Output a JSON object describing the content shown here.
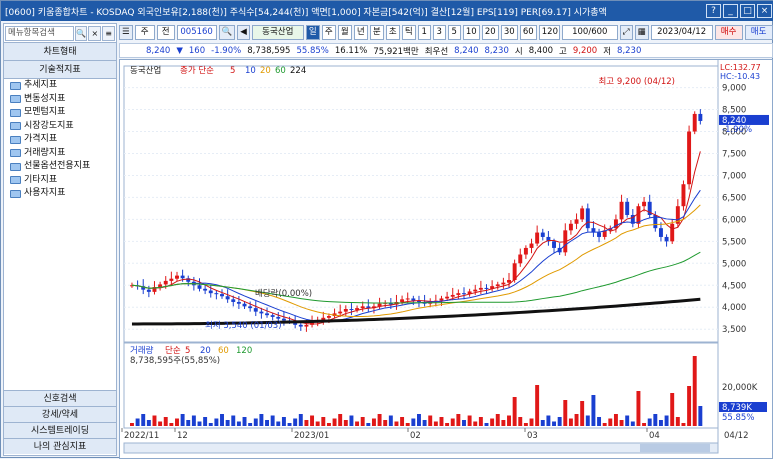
{
  "title": {
    "text": "[0600] 키움종합차트 - KOSDAQ 외국인보유[2,188(천)] 주식수[54,244(천)] 액면[1,000] 자본금[542(억)] 결산[12월] EPS[119] PER[69.17] 시가총액",
    "buttons": [
      "?",
      "_",
      "□",
      "×"
    ]
  },
  "sidebar": {
    "search_placeholder": "메뉴항목검색",
    "search_icon": "search-icon",
    "tab_chart_type": "차트형태",
    "tab_technical": "기술적지표",
    "items": [
      "추세지표",
      "변동성지표",
      "모멘텀지표",
      "시장강도지표",
      "가격지표",
      "거래량지표",
      "선물옵션전용지표",
      "기타지표",
      "사용자지표"
    ],
    "bottom_tabs": [
      "신호검색",
      "강세/약세",
      "시스템트레이딩",
      "나의 관심지표"
    ]
  },
  "toolbar": {
    "period": "주",
    "mode": "전",
    "code": "005160",
    "stock_name": "동국산업",
    "intervals": [
      "일",
      "주",
      "월",
      "년",
      "분",
      "초",
      "틱"
    ],
    "numbers": [
      "1",
      "3",
      "5",
      "10",
      "20",
      "30",
      "60",
      "120"
    ],
    "count": "100/600",
    "date": "2023/04/12",
    "buy": "매수",
    "sell": "매도"
  },
  "infobar": {
    "price": "8,240",
    "change": "160",
    "change_pct": "-1.90%",
    "volume": "8,738,595",
    "vol_pct": "55.85%",
    "turnover": "16.11%",
    "amount": "75,921백만",
    "low_label": "최우선",
    "bid1": "8,240",
    "bid2": "8,230",
    "open_label": "시",
    "open": "8,400",
    "high_label": "고",
    "high": "9,200",
    "low2_label": "저",
    "low": "8,230"
  },
  "chart_data": {
    "type": "candlestick",
    "title": "동국산업",
    "legend": {
      "label": "종가 단순",
      "mas": [
        "5",
        "10",
        "20",
        "60",
        "224"
      ],
      "colors": [
        "#d21414",
        "#1a3fd0",
        "#e09a00",
        "#1f9a2f",
        "#111111"
      ]
    },
    "y_ticks": [
      "9,000",
      "8,500",
      "8,000",
      "7,500",
      "7,000",
      "6,500",
      "6,000",
      "5,500",
      "5,000",
      "4,500",
      "4,000",
      "3,500"
    ],
    "ylim": [
      3300,
      9400
    ],
    "current_price": "8,240",
    "current_pct": "-1.90%",
    "lc": "LC:132.77",
    "hc": "HC:-10.43",
    "annotations": {
      "high": "최고 9,200 (04/12)",
      "low": "최저 3,540 (01/03)",
      "dividend": "배당락(0.00%)"
    },
    "closes": [
      4500,
      4480,
      4400,
      4350,
      4460,
      4520,
      4600,
      4650,
      4720,
      4660,
      4580,
      4500,
      4420,
      4380,
      4320,
      4300,
      4250,
      4180,
      4120,
      4080,
      4020,
      3980,
      3900,
      3860,
      3820,
      3780,
      3740,
      3700,
      3680,
      3600,
      3560,
      3600,
      3650,
      3700,
      3760,
      3800,
      3860,
      3900,
      3960,
      3940,
      3980,
      4020,
      3980,
      4020,
      4080,
      4100,
      4060,
      4120,
      4180,
      4200,
      4150,
      4120,
      4080,
      4120,
      4150,
      4200,
      4240,
      4280,
      4320,
      4300,
      4360,
      4400,
      4440,
      4420,
      4480,
      4520,
      4560,
      4620,
      5000,
      5200,
      5350,
      5450,
      5700,
      5600,
      5500,
      5350,
      5250,
      5750,
      5900,
      6000,
      6250,
      5800,
      5700,
      5600,
      5750,
      5800,
      6000,
      6400,
      6100,
      5900,
      6300,
      6400,
      6100,
      5800,
      5600,
      5500,
      5900,
      6300,
      6800,
      8000,
      8400,
      8240
    ],
    "volume_panel": {
      "title": "거래량",
      "legend": [
        "단순",
        "5",
        "20",
        "60",
        "120"
      ],
      "info": "8,738,595주(55,85%)",
      "ticks": [
        "20,000K"
      ],
      "current": "8,739K",
      "current_pct": "55.85%"
    },
    "x_ticks": [
      "2022/11",
      "12",
      "2023/01",
      "02",
      "03",
      "04"
    ],
    "date_label": "04/12"
  }
}
